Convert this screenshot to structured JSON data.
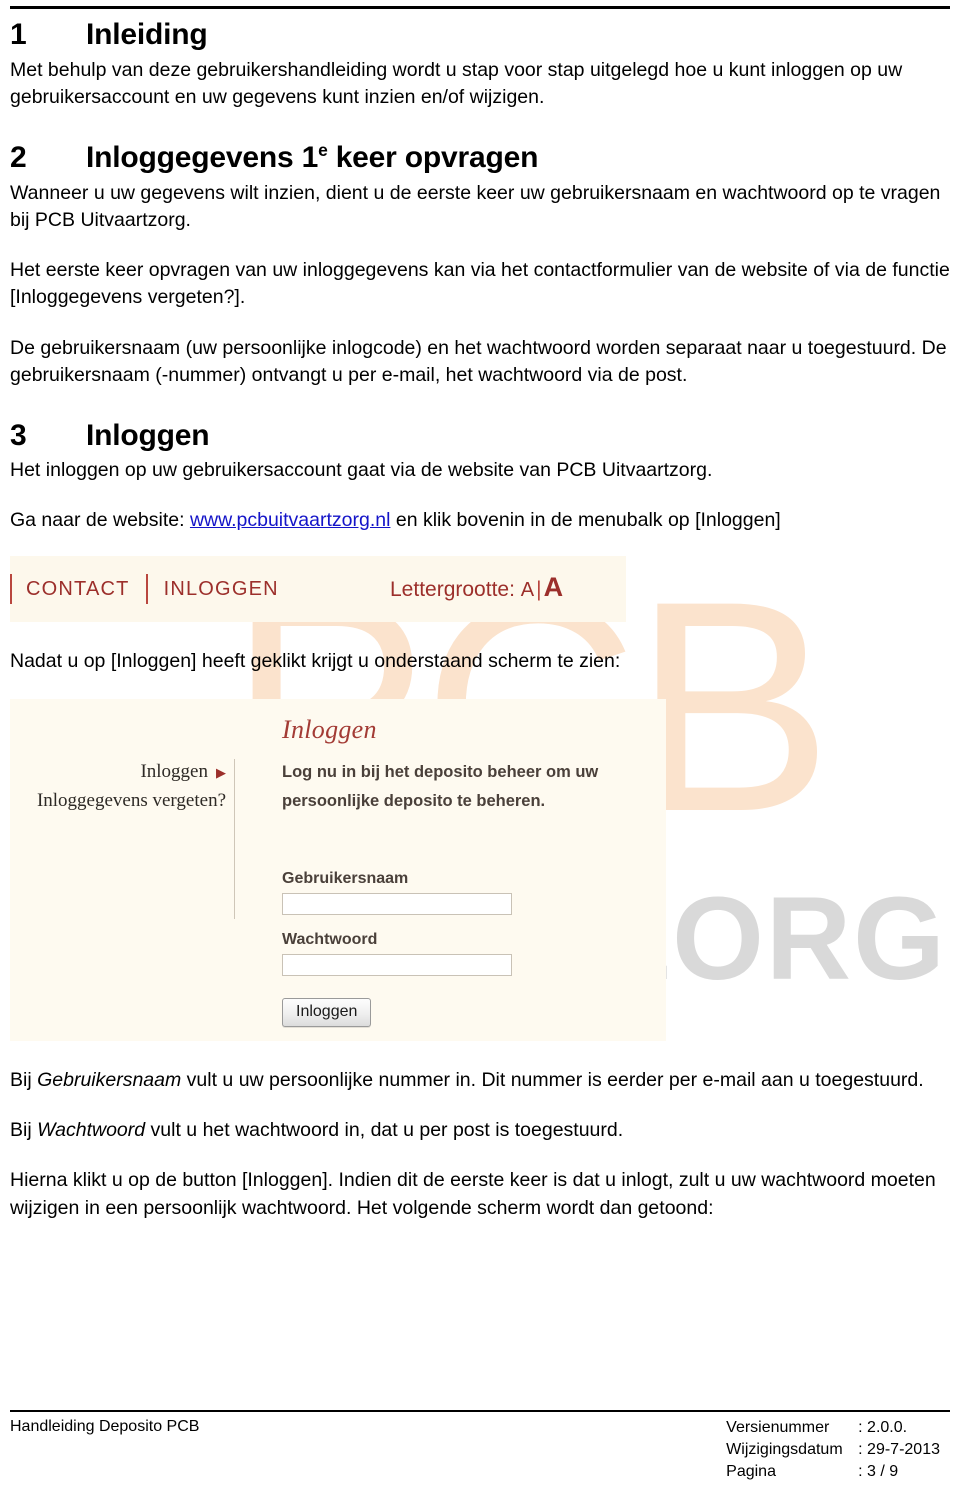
{
  "document": {
    "sections": [
      {
        "number": "1",
        "title": "Inleiding",
        "paragraph": "Met behulp van deze gebruikershandleiding wordt u stap voor stap uitgelegd hoe u kunt inloggen op uw gebruikersaccount en uw gegevens kunt inzien en/of wijzigen."
      },
      {
        "number": "2",
        "title_pre": "Inloggegevens 1",
        "title_sup": "e",
        "title_post": " keer opvragen",
        "paragraph1": "Wanneer u uw gegevens wilt inzien, dient u de eerste keer uw gebruikersnaam en wachtwoord op te vragen bij PCB Uitvaartzorg.",
        "paragraph2": "Het eerste keer opvragen van uw inloggegevens kan via het contactformulier van de website of via de functie [Inloggegevens vergeten?].",
        "paragraph3": "De gebruikersnaam (uw persoonlijke inlogcode) en het wachtwoord worden separaat naar u toegestuurd. De gebruikersnaam (-nummer) ontvangt u per e-mail, het wachtwoord via de post."
      },
      {
        "number": "3",
        "title": "Inloggen",
        "paragraph1": "Het inloggen op uw gebruikersaccount gaat via de website van PCB Uitvaartzorg.",
        "link_lead": "Ga naar de website: ",
        "link_text": "www.pcbuitvaartzorg.nl",
        "link_tail": " en klik bovenin in de menubalk op [Inloggen]",
        "caption_after_menubar": "Nadat u op [Inloggen] heeft geklikt krijgt u onderstaand scherm te zien:",
        "after_shot_p1_lead": "Bij ",
        "after_shot_p1_em": "Gebruikersnaam",
        "after_shot_p1_tail": " vult u uw persoonlijke nummer in. Dit nummer is eerder per e-mail aan u toegestuurd.",
        "after_shot_p2_lead": "Bij ",
        "after_shot_p2_em": "Wachtwoord",
        "after_shot_p2_tail": " vult u het wachtwoord in, dat u per post is toegestuurd.",
        "after_shot_p3": "Hierna klikt u op de button [Inloggen]. Indien dit de eerste keer is dat u inlogt, zult u uw wachtwoord moeten wijzigen in een persoonlijk wachtwoord. Het volgende scherm wordt dan getoond:"
      }
    ]
  },
  "menubar_screenshot": {
    "contact_label": "CONTACT",
    "inloggen_label": "INLOGGEN",
    "fontsize_label": "Lettergrootte:",
    "fontsize_small": "A",
    "fontsize_separator": "|",
    "fontsize_large": "A",
    "accent_color": "#9c2f2b",
    "background_color": "#fdf8ec"
  },
  "login_screenshot": {
    "sidebar": {
      "items": [
        {
          "label": "Inloggen",
          "arrow": "▶"
        },
        {
          "label": "Inloggegevens vergeten?",
          "arrow": ""
        }
      ]
    },
    "title": "Inloggen",
    "intro_line1": "Log nu in bij het deposito beheer om uw",
    "intro_line2": "persoonlijke deposito te beheren.",
    "username_label": "Gebruikersnaam",
    "username_value": "",
    "password_label": "Wachtwoord",
    "password_value": "",
    "submit_label": "Inloggen",
    "title_color": "#a33b35",
    "background_color": "#fefaf0"
  },
  "watermark": {
    "logo_text": "PCB",
    "word_text": "ZORG",
    "logo_color": "#fbe3cd",
    "word_color": "#d9d9d9"
  },
  "footer": {
    "left_text": "Handleiding Deposito PCB",
    "rows": [
      {
        "key": "Versienummer",
        "value": ": 2.0.0."
      },
      {
        "key": "Wijzigingsdatum",
        "value": ": 29-7-2013"
      },
      {
        "key": "Pagina",
        "value": ": 3 / 9"
      }
    ]
  }
}
